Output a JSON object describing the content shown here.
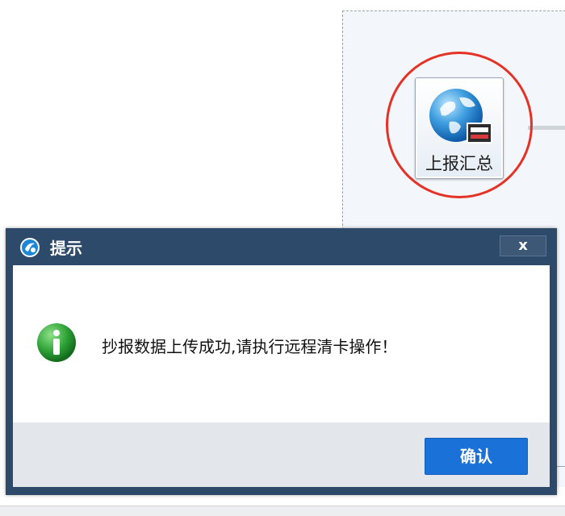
{
  "background": {
    "tile": {
      "label": "上报汇总",
      "icon": "globe-card-icon"
    },
    "highlight_color": "#e53227"
  },
  "dialog": {
    "title": "提示",
    "title_icon": "app-logo-icon",
    "close_label": "x",
    "info_icon": "info-icon",
    "message": "抄报数据上传成功,请执行远程清卡操作！",
    "ok_label": "确认",
    "colors": {
      "frame": "#2d4a6a",
      "button": "#1a72d8",
      "footer": "#e3e6ea"
    }
  }
}
